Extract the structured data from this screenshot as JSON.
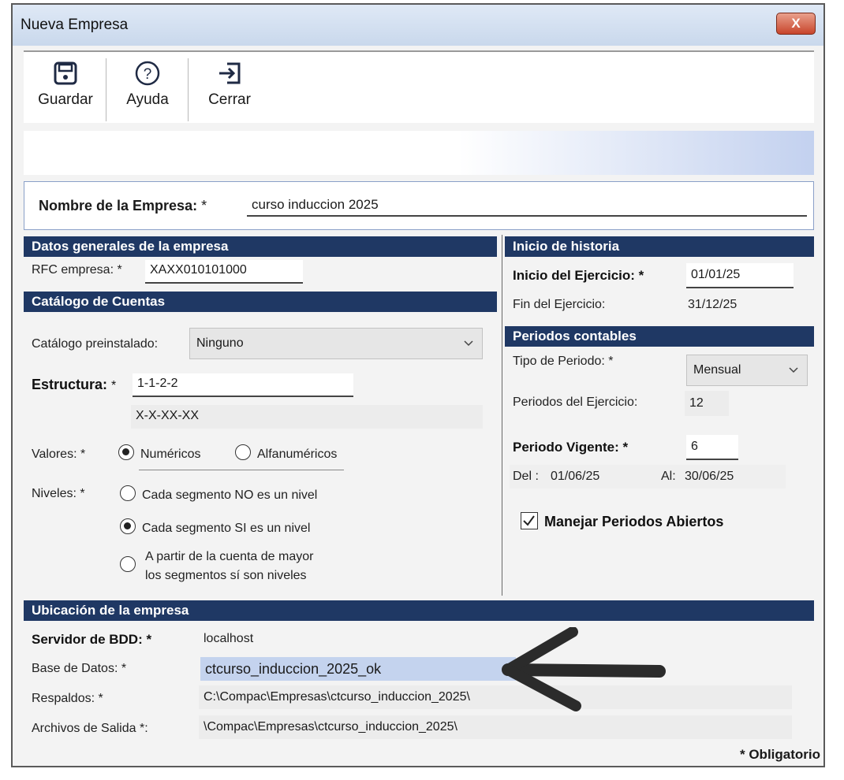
{
  "window": {
    "title": "Nueva Empresa",
    "close_label": "X"
  },
  "toolbar": {
    "save_label": "Guardar",
    "help_label": "Ayuda",
    "close_label": "Cerrar"
  },
  "company_name": {
    "label": "Nombre de la Empresa:",
    "required_mark": "*",
    "value": "curso induccion 2025"
  },
  "general": {
    "header": "Datos generales de la empresa",
    "rfc_label": "RFC empresa: *",
    "rfc_value": "XAXX010101000"
  },
  "catalog": {
    "header": "Catálogo de Cuentas",
    "preinstalled_label": "Catálogo preinstalado:",
    "preinstalled_value": "Ninguno",
    "structure_label": "Estructura:",
    "structure_required": "*",
    "structure_value": "1-1-2-2",
    "structure_mask": "X-X-XX-XX",
    "values_label": "Valores: *",
    "values_options": [
      "Numéricos",
      "Alfanuméricos"
    ],
    "values_selected": "Numéricos",
    "levels_label": "Niveles: *",
    "levels_options": [
      "Cada segmento NO es un nivel",
      "Cada segmento SI es un nivel",
      "A partir de la cuenta de mayor",
      "los segmentos sí son niveles"
    ],
    "levels_selected": "Cada segmento SI es un nivel"
  },
  "history": {
    "header": "Inicio de historia",
    "start_label": "Inicio del Ejercicio: *",
    "start_value": "01/01/25",
    "end_label": "Fin del Ejercicio:",
    "end_value": "31/12/25"
  },
  "periods": {
    "header": "Periodos contables",
    "type_label": "Tipo de Periodo: *",
    "type_value": "Mensual",
    "count_label": "Periodos del Ejercicio:",
    "count_value": "12",
    "current_label": "Periodo Vigente: *",
    "current_value": "6",
    "from_label": "Del :",
    "from_value": "01/06/25",
    "to_label": "Al:",
    "to_value": "30/06/25",
    "open_periods_label": "Manejar Periodos Abiertos",
    "open_periods_checked": true
  },
  "location": {
    "header": "Ubicación de la empresa",
    "server_label": "Servidor de BDD: *",
    "server_value": "localhost",
    "db_label": "Base de Datos: *",
    "db_value": "ctcurso_induccion_2025_ok",
    "backup_label": "Respaldos: *",
    "backup_value": "C:\\Compac\\Empresas\\ctcurso_induccion_2025\\",
    "output_label": "Archivos de Salida *:",
    "output_value": "\\Compac\\Empresas\\ctcurso_induccion_2025\\"
  },
  "footer": {
    "required_note": "* Obligatorio"
  },
  "colors": {
    "section_header": "#1f3864",
    "highlight": "#c4d3ee",
    "close_button": "#c8452c"
  }
}
